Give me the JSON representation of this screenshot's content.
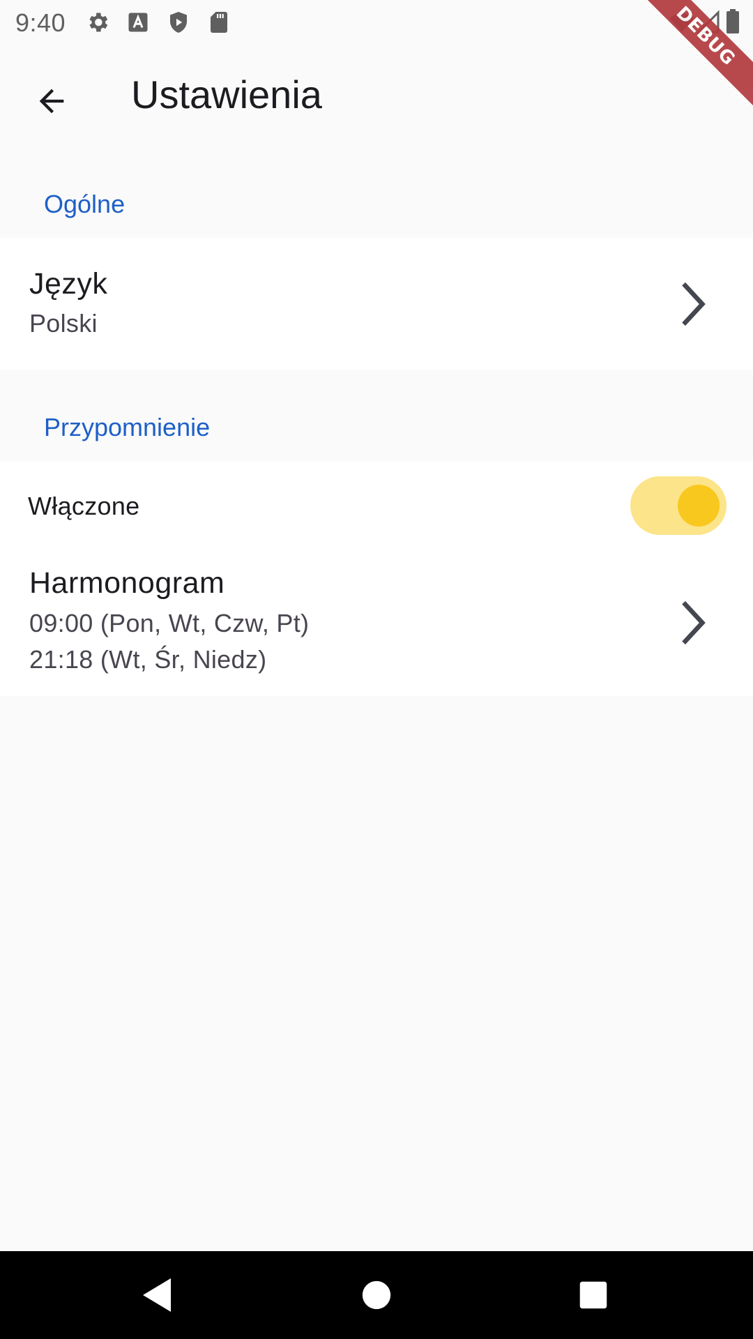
{
  "status_bar": {
    "time": "9:40",
    "icons": [
      "gear-icon",
      "a-letter-icon",
      "play-shield-icon",
      "sd-card-icon",
      "wifi-icon",
      "signal-icon",
      "battery-icon"
    ]
  },
  "debug_banner": {
    "label": "DEBUG",
    "color": "#B23A3F"
  },
  "app_bar": {
    "title": "Ustawienia",
    "back_icon": "arrow-back-icon"
  },
  "sections": {
    "general": {
      "header": "Ogólne",
      "language": {
        "title": "Język",
        "value": "Polski"
      }
    },
    "reminder": {
      "header": "Przypomnienie",
      "enabled": {
        "label": "Włączone",
        "on": true
      },
      "schedule": {
        "title": "Harmonogram",
        "line1": "09:00 (Pon, Wt, Czw, Pt)",
        "line2": "21:18 (Wt, Śr, Niedz)"
      }
    }
  },
  "colors": {
    "accent": "#1E5FC8",
    "toggle_track": "#FCE48A",
    "toggle_thumb": "#F9C81E",
    "background": "#FAFAFA",
    "card": "#FFFFFF"
  },
  "nav_bar": {
    "buttons": [
      "back-triangle-icon",
      "home-circle-icon",
      "recents-square-icon"
    ]
  }
}
